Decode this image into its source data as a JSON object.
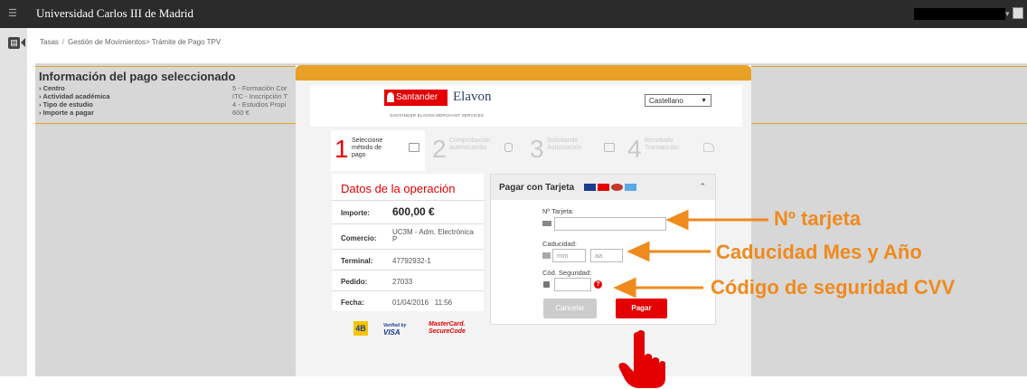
{
  "topbar": {
    "title": "Universidad Carlos III de Madrid",
    "menu_icon": "menu-icon",
    "user_icon": "user-avatar-icon"
  },
  "breadcrumb": {
    "items": [
      "Tasas",
      "Gestión de Movimientos> Trámite de Pago TPV"
    ]
  },
  "info": {
    "title": "Información del pago seleccionado",
    "rows": [
      {
        "label": "Centro",
        "value": "5 - Formación Cor"
      },
      {
        "label": "Actividad académica",
        "value": "ITC - Inscripción T"
      },
      {
        "label": "Tipo de estudio",
        "value": "4 - Estudios Propi"
      },
      {
        "label": "Importe a pagar",
        "value": "600 €"
      }
    ]
  },
  "modal": {
    "brand": {
      "santander": "Santander",
      "elavon": "Elavon",
      "subtitle": "SANTANDER ELAVON MERCHANT SERVICES"
    },
    "language": "Castellano",
    "steps": [
      {
        "num": "1",
        "text": "Seleccione método de pago"
      },
      {
        "num": "2",
        "text": "Comprobación autenticación"
      },
      {
        "num": "3",
        "text": "Solicitando Autorización"
      },
      {
        "num": "4",
        "text": "Resultado Transacción"
      }
    ],
    "operation": {
      "title": "Datos de la operación",
      "importe_label": "Importe:",
      "importe_value": "600,00 €",
      "comercio_label": "Comercio:",
      "comercio_value": "UC3M - Adm. Electrónica P",
      "terminal_label": "Terminal:",
      "terminal_value": "47792932-1",
      "pedido_label": "Pedido:",
      "pedido_value": "27033",
      "fecha_label": "Fecha:",
      "fecha_value": "01/04/2016   11:56"
    },
    "payment": {
      "title": "Pagar con Tarjeta",
      "card_label": "Nº Tarjeta:",
      "expiry_label": "Caducidad:",
      "month_placeholder": "mm",
      "year_placeholder": "aa",
      "cvv_label": "Cód. Seguridad:",
      "cancel": "Cancelar",
      "pay": "Pagar"
    },
    "badges": {
      "fourb": "4B",
      "verified": "Verified by",
      "visa": "VISA",
      "mastercard": "MasterCard.",
      "securecode": "SecureCode"
    }
  },
  "annotations": {
    "card": "Nº tarjeta",
    "expiry": "Caducidad Mes y Año",
    "cvv": "Código de seguridad CVV",
    "color": "#ef8a1d"
  },
  "colors": {
    "santander_red": "#e40000",
    "header_orange": "#e8a126",
    "topbar": "#2b2b2b"
  }
}
